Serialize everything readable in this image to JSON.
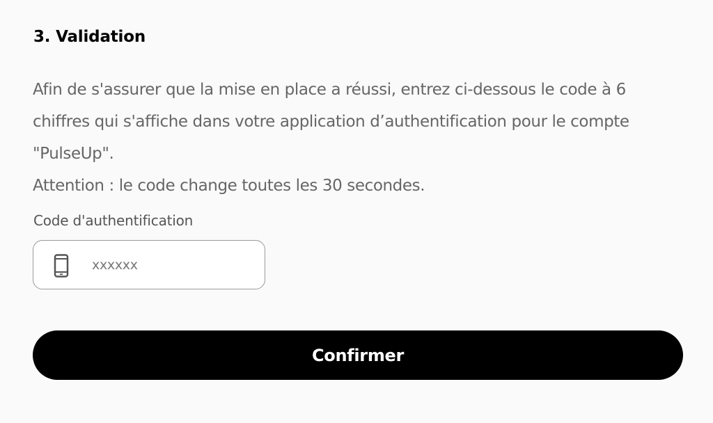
{
  "section": {
    "title": "3. Validation",
    "paragraph": "Afin de s'assurer que la mise en place a réussi, entrez ci-dessous le code à 6 chiffres qui s'affiche dans votre application d’authentification pour le compte \"PulseUp\".",
    "warning": "Attention : le code change toutes les 30 secondes."
  },
  "field": {
    "label": "Code d'authentification",
    "value": "",
    "placeholder": "xxxxxx",
    "icon": "smartphone-icon"
  },
  "actions": {
    "confirm_label": "Confirmer"
  },
  "colors": {
    "background": "#fafafa",
    "button_bg": "#000000",
    "button_text": "#ffffff",
    "body_text": "#666666"
  }
}
